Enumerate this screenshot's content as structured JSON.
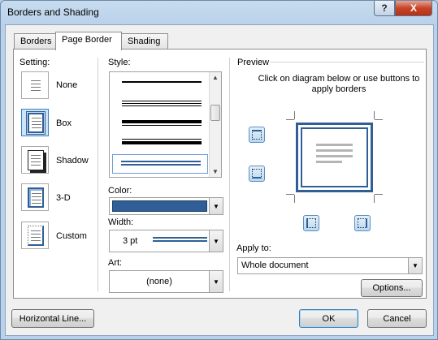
{
  "window": {
    "title": "Borders and Shading"
  },
  "titlebar_buttons": {
    "help": "?",
    "close": "X"
  },
  "tabs": [
    {
      "label": "Borders",
      "active": false
    },
    {
      "label": "Page Border",
      "active": true
    },
    {
      "label": "Shading",
      "active": false
    }
  ],
  "setting": {
    "label": "Setting:",
    "options": [
      {
        "label": "None"
      },
      {
        "label": "Box",
        "selected": true
      },
      {
        "label": "Shadow"
      },
      {
        "label": "3-D"
      },
      {
        "label": "Custom"
      }
    ]
  },
  "style": {
    "label": "Style:"
  },
  "color": {
    "label": "Color:",
    "value_color": "#2f5f96"
  },
  "width": {
    "label": "Width:",
    "value": "3 pt"
  },
  "art": {
    "label": "Art:",
    "value": "(none)"
  },
  "preview": {
    "label": "Preview",
    "instruction": "Click on diagram below or use buttons to apply borders",
    "border_color": "#2f5f96"
  },
  "apply_to": {
    "label": "Apply to:",
    "value": "Whole document"
  },
  "buttons": {
    "options": "Options...",
    "horizontal_line": "Horizontal Line...",
    "ok": "OK",
    "cancel": "Cancel"
  }
}
